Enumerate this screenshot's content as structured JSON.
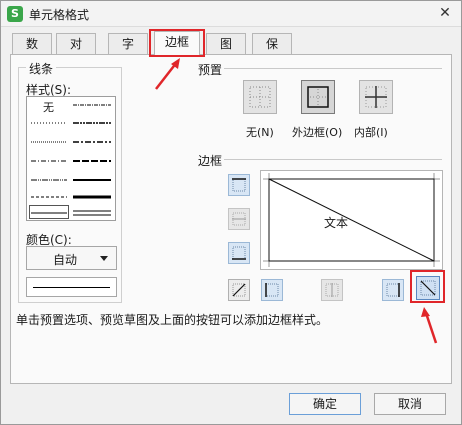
{
  "window": {
    "app_icon": "S",
    "title": "单元格格式",
    "close": "✕"
  },
  "tabs": [
    {
      "label": "数字"
    },
    {
      "label": "对齐"
    },
    {
      "label": "字体"
    },
    {
      "label": "边框"
    },
    {
      "label": "图案"
    },
    {
      "label": "保护"
    }
  ],
  "active_tab": "边框",
  "line": {
    "group_label": "线条",
    "style_label": "样式(S):",
    "none_label": "无",
    "color_label": "颜色(C):",
    "color_value": "自动"
  },
  "presets": {
    "title": "预置",
    "items": [
      {
        "label": "无(N)"
      },
      {
        "label": "外边框(O)"
      },
      {
        "label": "内部(I)"
      }
    ]
  },
  "border": {
    "title": "边框",
    "preview_text": "文本"
  },
  "hint": "单击预置选项、预览草图及上面的按钮可以添加边框样式。",
  "buttons": {
    "ok": "确定",
    "cancel": "取消"
  },
  "colors": {
    "highlight": "#e0262a",
    "accent": "#3aa64a"
  }
}
